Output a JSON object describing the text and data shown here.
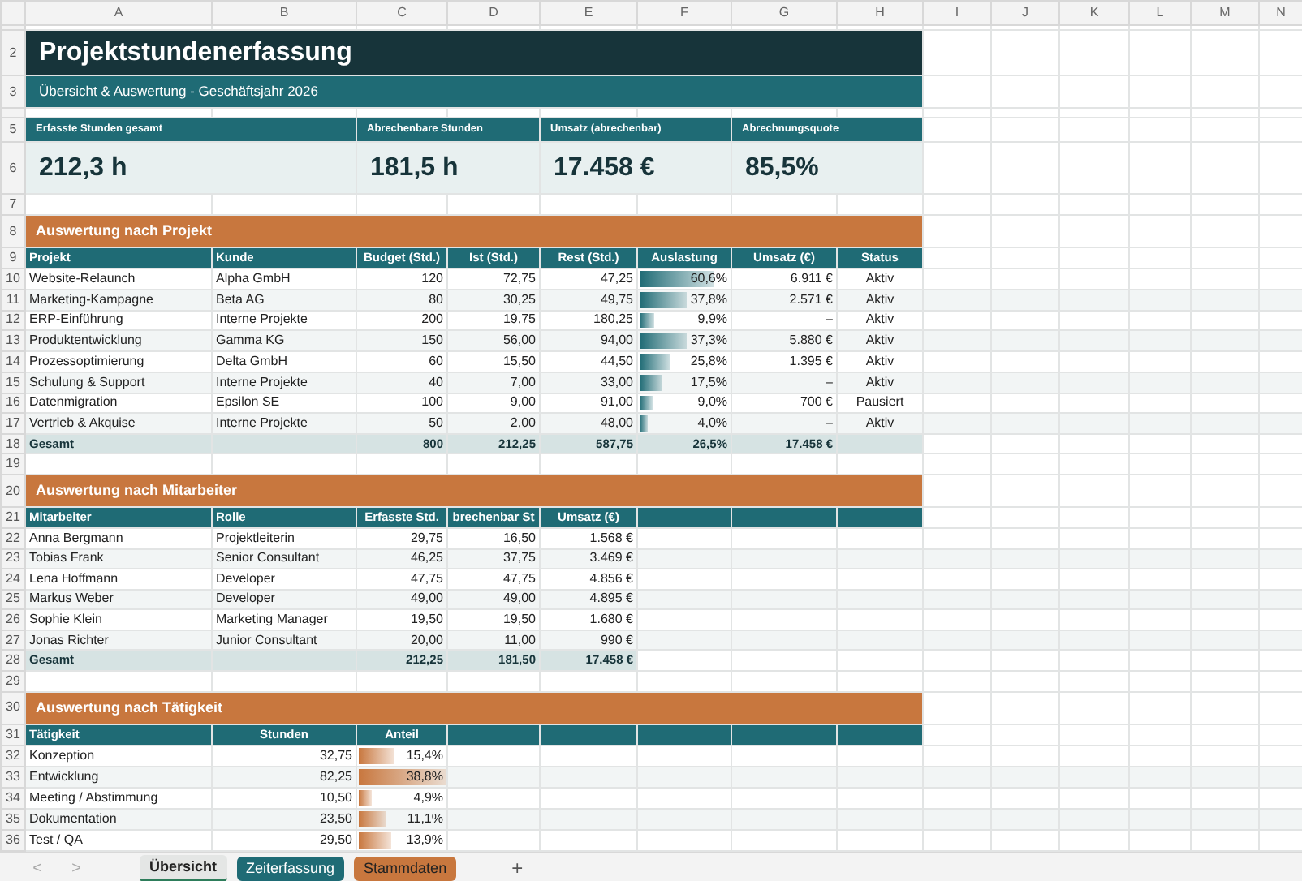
{
  "column_headers": [
    "A",
    "B",
    "C",
    "D",
    "E",
    "F",
    "G",
    "H",
    "I",
    "J",
    "K",
    "L",
    "M",
    "N"
  ],
  "row_numbers": [
    "2",
    "3",
    "5",
    "6",
    "7",
    "8",
    "9",
    "10",
    "11",
    "12",
    "13",
    "14",
    "15",
    "16",
    "17",
    "18",
    "19",
    "20",
    "21",
    "22",
    "23",
    "24",
    "25",
    "26",
    "27",
    "28",
    "29",
    "30",
    "31",
    "32",
    "33",
    "34",
    "35",
    "36"
  ],
  "title": "Projektstundenerfassung",
  "subtitle": "Übersicht & Auswertung - Geschäftsjahr 2026",
  "kpis": [
    {
      "label": "Erfasste Stunden gesamt",
      "value": "212,3 h"
    },
    {
      "label": "Abrechenbare Stunden",
      "value": "181,5 h"
    },
    {
      "label": "Umsatz (abrechenbar)",
      "value": "17.458 €"
    },
    {
      "label": "Abrechnungsquote",
      "value": "85,5%"
    }
  ],
  "projects": {
    "heading": "Auswertung nach Projekt",
    "columns": [
      "Projekt",
      "Kunde",
      "Budget (Std.)",
      "Ist (Std.)",
      "Rest (Std.)",
      "Auslastung",
      "Umsatz (€)",
      "Status"
    ],
    "rows": [
      {
        "cells": [
          "Website-Relaunch",
          "Alpha GmbH",
          "120",
          "72,75",
          "47,25",
          "60,6%",
          "6.911 €",
          "Aktiv"
        ],
        "level": 0.8
      },
      {
        "cells": [
          "Marketing-Kampagne",
          "Beta AG",
          "80",
          "30,25",
          "49,75",
          "37,8%",
          "2.571 €",
          "Aktiv"
        ],
        "level": 0.5
      },
      {
        "cells": [
          "ERP-Einführung",
          "Interne Projekte",
          "200",
          "19,75",
          "180,25",
          "9,9%",
          "–",
          "Aktiv"
        ],
        "level": 0.15
      },
      {
        "cells": [
          "Produktentwicklung",
          "Gamma KG",
          "150",
          "56,00",
          "94,00",
          "37,3%",
          "5.880 €",
          "Aktiv"
        ],
        "level": 0.5
      },
      {
        "cells": [
          "Prozessoptimierung",
          "Delta GmbH",
          "60",
          "15,50",
          "44,50",
          "25,8%",
          "1.395 €",
          "Aktiv"
        ],
        "level": 0.34
      },
      {
        "cells": [
          "Schulung & Support",
          "Interne Projekte",
          "40",
          "7,00",
          "33,00",
          "17,5%",
          "–",
          "Aktiv"
        ],
        "level": 0.24
      },
      {
        "cells": [
          "Datenmigration",
          "Epsilon SE",
          "100",
          "9,00",
          "91,00",
          "9,0%",
          "700 €",
          "Pausiert"
        ],
        "level": 0.14
      },
      {
        "cells": [
          "Vertrieb & Akquise",
          "Interne Projekte",
          "50",
          "2,00",
          "48,00",
          "4,0%",
          "–",
          "Aktiv"
        ],
        "level": 0.08
      }
    ],
    "total": {
      "label": "Gesamt",
      "values": [
        "800",
        "212,25",
        "587,75",
        "26,5%",
        "17.458 €"
      ]
    }
  },
  "employees": {
    "heading": "Auswertung nach Mitarbeiter",
    "columns": [
      "Mitarbeiter",
      "Rolle",
      "Erfasste Std.",
      "brechenbar St",
      "Umsatz (€)"
    ],
    "rows": [
      [
        "Anna Bergmann",
        "Projektleiterin",
        "29,75",
        "16,50",
        "1.568 €"
      ],
      [
        "Tobias Frank",
        "Senior Consultant",
        "46,25",
        "37,75",
        "3.469 €"
      ],
      [
        "Lena Hoffmann",
        "Developer",
        "47,75",
        "47,75",
        "4.856 €"
      ],
      [
        "Markus Weber",
        "Developer",
        "49,00",
        "49,00",
        "4.895 €"
      ],
      [
        "Sophie Klein",
        "Marketing Manager",
        "19,50",
        "19,50",
        "1.680 €"
      ],
      [
        "Jonas Richter",
        "Junior Consultant",
        "20,00",
        "11,00",
        "990 €"
      ]
    ],
    "total": {
      "label": "Gesamt",
      "values": [
        "212,25",
        "181,50",
        "17.458 €"
      ]
    }
  },
  "activities": {
    "heading": "Auswertung nach Tätigkeit",
    "columns": [
      "Tätigkeit",
      "Stunden",
      "Anteil"
    ],
    "rows": [
      {
        "cells": [
          "Konzeption",
          "32,75",
          "15,4%"
        ],
        "level": 0.4
      },
      {
        "cells": [
          "Entwicklung",
          "82,25",
          "38,8%"
        ],
        "level": 0.98
      },
      {
        "cells": [
          "Meeting / Abstimmung",
          "10,50",
          "4,9%"
        ],
        "level": 0.15
      },
      {
        "cells": [
          "Dokumentation",
          "23,50",
          "11,1%"
        ],
        "level": 0.3
      },
      {
        "cells": [
          "Test / QA",
          "29,50",
          "13,9%"
        ],
        "level": 0.36
      }
    ]
  },
  "sheet_nav": [
    "<",
    ">"
  ],
  "sheet_tabs": [
    {
      "label": "Übersicht",
      "selected": true,
      "color": "#e4e6e5"
    },
    {
      "label": "Zeiterfassung",
      "selected": false,
      "color": "#1f6b75"
    },
    {
      "label": "Stammdaten",
      "selected": false,
      "color": "#c8773e"
    }
  ],
  "add_sheet": "+"
}
